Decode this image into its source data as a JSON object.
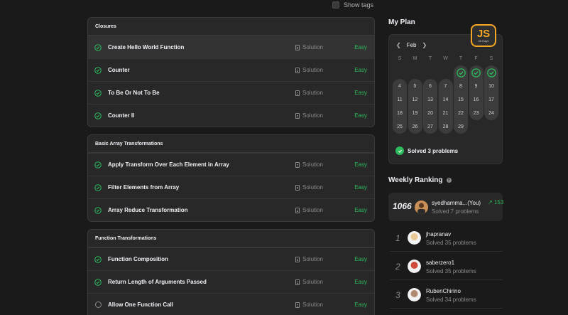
{
  "top": {
    "show_tags": "Show tags"
  },
  "sections": [
    {
      "title": "Closures",
      "problems": [
        {
          "title": "Create Hello World Function",
          "solution": "Solution",
          "difficulty": "Easy",
          "solved": true,
          "active": true
        },
        {
          "title": "Counter",
          "solution": "Solution",
          "difficulty": "Easy",
          "solved": true
        },
        {
          "title": "To Be Or Not To Be",
          "solution": "Solution",
          "difficulty": "Easy",
          "solved": true
        },
        {
          "title": "Counter II",
          "solution": "Solution",
          "difficulty": "Easy",
          "solved": true
        }
      ]
    },
    {
      "title": "Basic Array Transformations",
      "problems": [
        {
          "title": "Apply Transform Over Each Element in Array",
          "solution": "Solution",
          "difficulty": "Easy",
          "solved": true
        },
        {
          "title": "Filter Elements from Array",
          "solution": "Solution",
          "difficulty": "Easy",
          "solved": true
        },
        {
          "title": "Array Reduce Transformation",
          "solution": "Solution",
          "difficulty": "Easy",
          "solved": true
        }
      ]
    },
    {
      "title": "Function Transformations",
      "problems": [
        {
          "title": "Function Composition",
          "solution": "Solution",
          "difficulty": "Easy",
          "solved": true
        },
        {
          "title": "Return Length of Arguments Passed",
          "solution": "Solution",
          "difficulty": "Easy",
          "solved": true
        },
        {
          "title": "Allow One Function Call",
          "solution": "Solution",
          "difficulty": "Easy",
          "solved": false
        }
      ]
    }
  ],
  "plan": {
    "title": "My Plan",
    "badge_text": "JS",
    "badge_sub": "30 Days",
    "month": "Feb",
    "weekdays": [
      "S",
      "M",
      "T",
      "W",
      "T",
      "F",
      "S"
    ],
    "solved_days": [
      1,
      2,
      3
    ],
    "days": [
      [
        null,
        null,
        null,
        null,
        1,
        2,
        3
      ],
      [
        4,
        5,
        6,
        7,
        8,
        9,
        10
      ],
      [
        11,
        12,
        13,
        14,
        15,
        16,
        17
      ],
      [
        18,
        19,
        20,
        21,
        22,
        23,
        24
      ],
      [
        25,
        26,
        27,
        28,
        29,
        null,
        null
      ]
    ],
    "summary": "Solved 3 problems"
  },
  "ranking": {
    "title": "Weekly Ranking",
    "me": {
      "rank": "1066",
      "name": "syedhamma...(You)",
      "solved": "Solved 7 problems",
      "delta": "↗ 153"
    },
    "rows": [
      {
        "rank": "1",
        "name": "jhapranav",
        "solved": "Solved 35 problems"
      },
      {
        "rank": "2",
        "name": "saberzero1",
        "solved": "Solved 35 problems"
      },
      {
        "rank": "3",
        "name": "RubenChirino",
        "solved": "Solved 34 problems"
      }
    ]
  },
  "colors": {
    "easy": "#2cbb5d",
    "accent": "#f5a623",
    "bg": "#1a1a1a",
    "card": "#282828"
  }
}
